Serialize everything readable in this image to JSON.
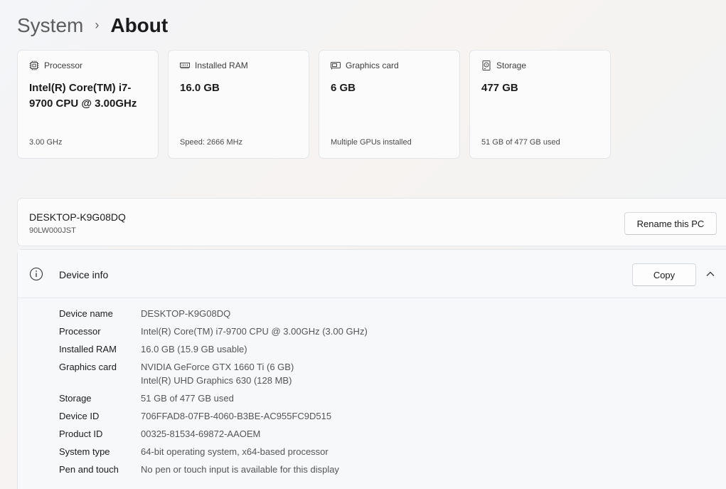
{
  "breadcrumb": {
    "parent": "System",
    "separator": "›",
    "current": "About"
  },
  "cards": [
    {
      "label": "Processor",
      "value": "Intel(R) Core(TM) i7-9700 CPU @ 3.00GHz",
      "sub": "3.00 GHz",
      "icon": "processor-icon"
    },
    {
      "label": "Installed RAM",
      "value": "16.0 GB",
      "sub": "Speed: 2666 MHz",
      "icon": "ram-icon"
    },
    {
      "label": "Graphics card",
      "value": "6 GB",
      "sub": "Multiple GPUs installed",
      "icon": "graphics-card-icon"
    },
    {
      "label": "Storage",
      "value": "477 GB",
      "sub": "51 GB of 477 GB used",
      "icon": "storage-icon"
    }
  ],
  "pc": {
    "name": "DESKTOP-K9G08DQ",
    "model": "90LW000JST",
    "rename_label": "Rename this PC"
  },
  "device_info": {
    "title": "Device info",
    "copy_label": "Copy",
    "rows": [
      {
        "label": "Device name",
        "value": "DESKTOP-K9G08DQ"
      },
      {
        "label": "Processor",
        "value": "Intel(R) Core(TM) i7-9700 CPU @ 3.00GHz (3.00 GHz)"
      },
      {
        "label": "Installed RAM",
        "value": "16.0 GB (15.9 GB usable)"
      },
      {
        "label": "Graphics card",
        "value": "NVIDIA GeForce GTX 1660 Ti (6 GB)",
        "value2": "Intel(R) UHD Graphics 630 (128 MB)"
      },
      {
        "label": "Storage",
        "value": "51 GB of 477 GB used"
      },
      {
        "label": "Device ID",
        "value": "706FFAD8-07FB-4060-B3BE-AC955FC9D515"
      },
      {
        "label": "Product ID",
        "value": "00325-81534-69872-AAOEM"
      },
      {
        "label": "System type",
        "value": "64-bit operating system, x64-based processor"
      },
      {
        "label": "Pen and touch",
        "value": "No pen or touch input is available for this display"
      }
    ]
  }
}
